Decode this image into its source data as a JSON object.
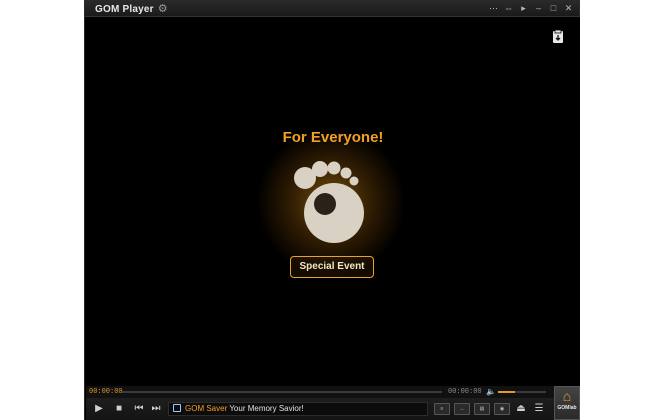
{
  "window": {
    "app_title": "GOM Player",
    "title_icons": [
      "gear-icon",
      "pin-icon",
      "compact-mode-icon",
      "play-mini-icon",
      "minimize-icon",
      "maximize-icon",
      "close-icon"
    ]
  },
  "video": {
    "headline": "For Everyone!",
    "event_button": "Special Event"
  },
  "seekbar": {
    "current_time": "00:00:00",
    "total_time": "00:00:00",
    "volume_level": 0.35
  },
  "controls": {
    "ticker_brand": "GOM Saver",
    "ticker_text": "Your Memory Savior!",
    "side_buttons": [
      "playlist-icon",
      "control-panel-icon",
      "subtitle-icon",
      "capture-icon"
    ],
    "gom_logo_label": "GOMlab"
  },
  "colors": {
    "accent": "#f0a028",
    "background": "#000000"
  }
}
